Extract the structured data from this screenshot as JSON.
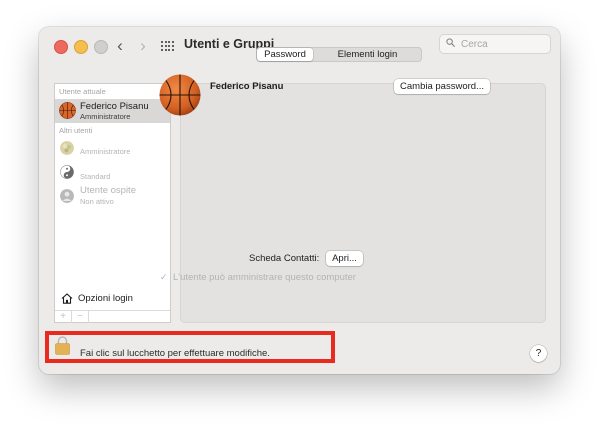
{
  "window": {
    "title": "Utenti e Gruppi",
    "search_placeholder": "Cerca",
    "back_glyph": "‹",
    "forward_glyph": "›"
  },
  "sidebar": {
    "current_header": "Utente attuale",
    "current_user": {
      "name": "Federico Pisanu",
      "role": "Amministratore",
      "avatar": "basketball-icon"
    },
    "others_header": "Altri utenti",
    "others": [
      {
        "name": "",
        "role": "Amministratore",
        "avatar": "flower-avatar-icon"
      },
      {
        "name": "",
        "role": "Standard",
        "avatar": "yin-yang-avatar-icon"
      },
      {
        "name": "Utente ospite",
        "role": "Non attivo",
        "avatar": "guest-avatar-icon"
      }
    ],
    "login_options": "Opzioni login",
    "add_glyph": "+",
    "remove_glyph": "−"
  },
  "tabs": [
    {
      "label": "Password",
      "selected": true
    },
    {
      "label": "Elementi login",
      "selected": false
    }
  ],
  "main": {
    "user_name": "Federico Pisanu",
    "change_password_button": "Cambia password...",
    "contacts_label": "Scheda Contatti:",
    "open_button": "Apri...",
    "admin_check_mark": "✓",
    "admin_checkbox_label": "L'utente può amministrare questo computer",
    "admin_checked": true
  },
  "footer": {
    "lock_text": "Fai clic sul lucchetto per effettuare modifiche.",
    "help_label": "?"
  },
  "colors": {
    "highlight": "#e82b1e",
    "window_bg": "#ecebea",
    "selection": "#d9d8d7",
    "basketball": "#d9672a"
  }
}
